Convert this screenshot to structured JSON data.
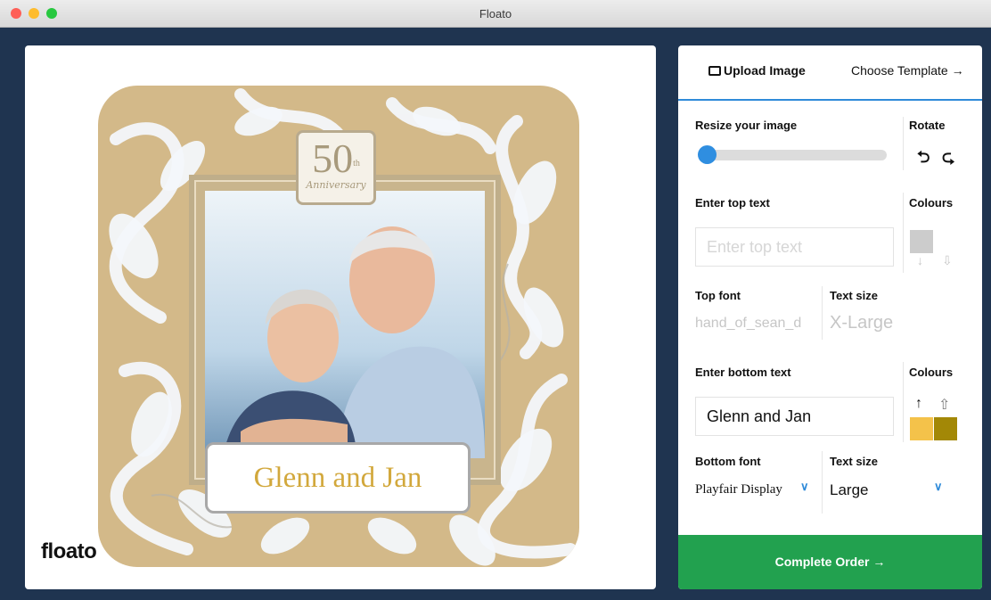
{
  "window": {
    "title": "Floato"
  },
  "preview": {
    "badge_number": "50",
    "badge_superscript": "th",
    "badge_caption": "Anniversary",
    "bottom_text": "Glenn and Jan",
    "logo_text": "floato"
  },
  "panel": {
    "tabs": {
      "upload_label": "Upload Image",
      "template_label": "Choose Template →"
    },
    "resize_label": "Resize your image",
    "resize_value": 0,
    "rotate_label": "Rotate",
    "rotate_left_icon": "⮌",
    "rotate_right_icon": "⮎",
    "top_text_label": "Enter top text",
    "top_text_placeholder": "Enter top text",
    "top_text_value": "",
    "colours_label": "Colours",
    "top_colour": "#cccccc",
    "top_font_label": "Top font",
    "top_font_value": "hand_of_sean_d",
    "text_size_label": "Text size",
    "top_text_size": "X-Large",
    "bottom_text_label": "Enter bottom text",
    "bottom_text_value": "Glenn and Jan",
    "bottom_colours_label": "Colours",
    "bottom_colour_1": "#f4c24a",
    "bottom_colour_2": "#a38806",
    "bottom_font_label": "Bottom font",
    "bottom_font_value": "Playfair Display",
    "bottom_text_size_label": "Text size",
    "bottom_text_size": "Large",
    "complete_label": "Complete Order →"
  },
  "colors": {
    "accent_blue": "#2f8bd9",
    "complete_green": "#22a14f",
    "coaster_gold": "#d3b989"
  }
}
